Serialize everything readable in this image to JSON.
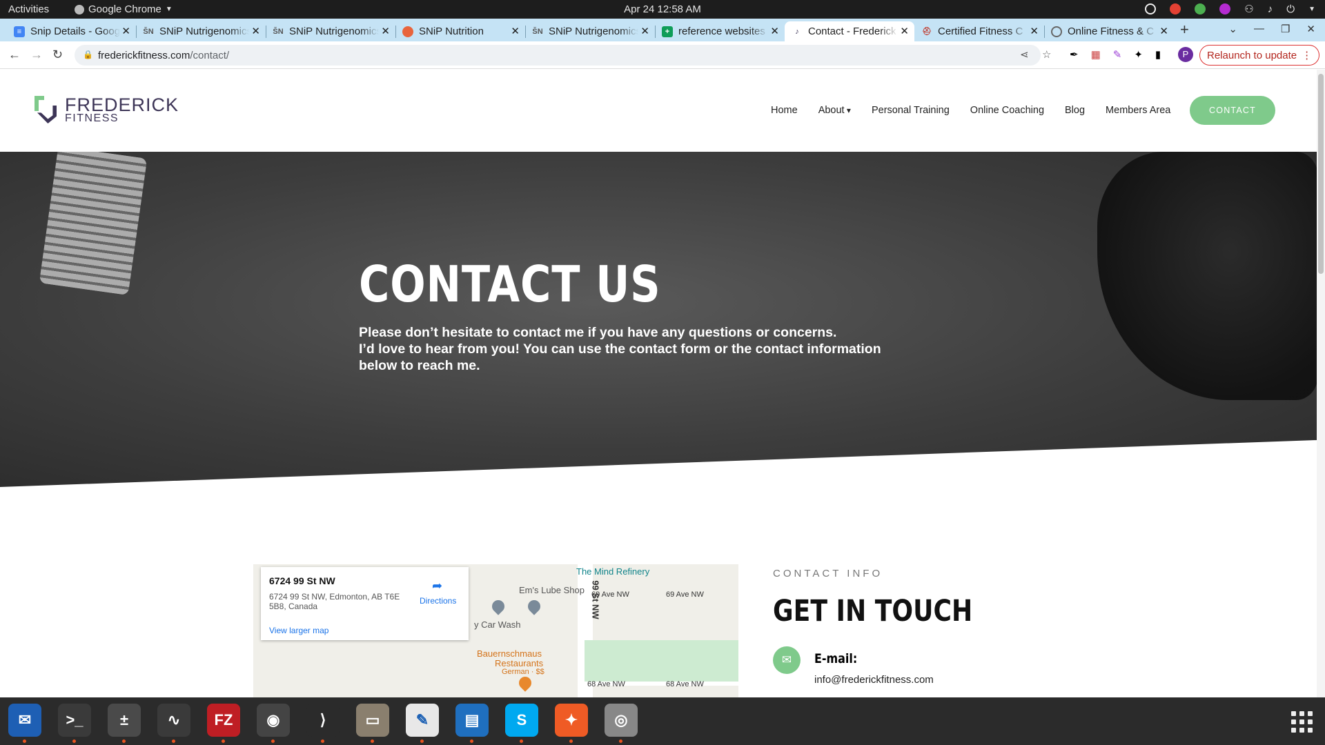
{
  "system": {
    "activities": "Activities",
    "app_name": "Google Chrome",
    "clock": "Apr 24  12:58 AM"
  },
  "tabs": [
    {
      "title": "Snip Details - Goog",
      "favicon": "docs-icon",
      "color": "#4285f4"
    },
    {
      "title": "SNiP Nutrigenomics",
      "favicon": "snip-icon",
      "color": "#555"
    },
    {
      "title": "SNiP Nutrigenomics",
      "favicon": "snip-icon",
      "color": "#555"
    },
    {
      "title": "SNiP Nutrition",
      "favicon": "snip-nutrition-icon",
      "color": "#e8643c"
    },
    {
      "title": "SNiP Nutrigenomics",
      "favicon": "snip-icon",
      "color": "#555"
    },
    {
      "title": "reference websites",
      "favicon": "sheets-icon",
      "color": "#0f9d58"
    },
    {
      "title": "Contact - Frederick",
      "favicon": "frederick-icon",
      "color": "#3d3557"
    },
    {
      "title": "Certified Fitness C",
      "favicon": "fitness-icon",
      "color": "#c0392b"
    },
    {
      "title": "Online Fitness & C",
      "favicon": "globe-icon",
      "color": "#666"
    }
  ],
  "address": {
    "host": "frederickfitness.com",
    "path": "/contact/"
  },
  "relaunch": "Relaunch to update",
  "profile_initial": "P",
  "site": {
    "logo": {
      "line1": "FREDERICK",
      "line2": "FITNESS"
    },
    "nav": [
      "Home",
      "About",
      "Personal Training",
      "Online Coaching",
      "Blog",
      "Members Area"
    ],
    "contact_btn": "CONTACT",
    "hero": {
      "title": "CONTACT US",
      "line1": "Please don’t hesitate to contact me if you have any questions or concerns.",
      "line2": "I’d love to hear from you! You can use the contact form or the contact information below to reach me."
    },
    "map": {
      "place": "6724 99 St NW",
      "full": "6724 99 St NW, Edmonton, AB T6E 5B8, Canada",
      "directions": "Directions",
      "larger": "View larger map",
      "labels": {
        "refinery": "The Mind Refinery",
        "lube": "Em's Lube Shop",
        "carwash": "y Car Wash",
        "rest1": "Bauernschmaus",
        "rest2": "Restaurants",
        "cuisine": "German · $$",
        "street": "99 St NW",
        "ave69a": "69 Ave NW",
        "ave69b": "69 Ave NW",
        "ave68a": "68 Ave NW",
        "ave68b": "68 Ave NW"
      }
    },
    "info": {
      "kicker": "CONTACT INFO",
      "title": "GET IN TOUCH",
      "email_label": "E-mail:",
      "email": "info@frederickfitness.com"
    }
  },
  "dock": [
    {
      "name": "thunderbird-icon",
      "color": "#1e5fb4",
      "glyph": "✉"
    },
    {
      "name": "terminal-icon",
      "color": "#3a3a3a",
      "glyph": ">_"
    },
    {
      "name": "calculator-icon",
      "color": "#4a4a4a",
      "glyph": "±"
    },
    {
      "name": "system-monitor-icon",
      "color": "#3a3a3a",
      "glyph": "∿"
    },
    {
      "name": "filezilla-icon",
      "color": "#bf1e24",
      "glyph": "FZ"
    },
    {
      "name": "chrome-icon",
      "color": "#444",
      "glyph": "◉"
    },
    {
      "name": "vscode-icon",
      "color": "#2b2b2b",
      "glyph": "⟩"
    },
    {
      "name": "files-icon",
      "color": "#8a7f6e",
      "glyph": "▭"
    },
    {
      "name": "text-editor-icon",
      "color": "#e8e8e8",
      "glyph": "✎"
    },
    {
      "name": "writer-icon",
      "color": "#1f6fbf",
      "glyph": "▤"
    },
    {
      "name": "skype-icon",
      "color": "#00a9f0",
      "glyph": "S"
    },
    {
      "name": "postman-icon",
      "color": "#ef5b25",
      "glyph": "✦"
    },
    {
      "name": "disks-icon",
      "color": "#888",
      "glyph": "◎"
    }
  ]
}
